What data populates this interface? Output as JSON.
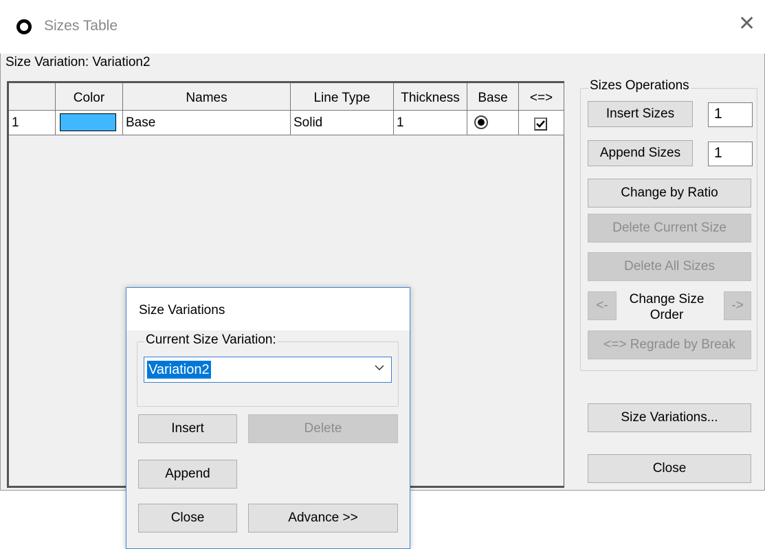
{
  "window": {
    "title": "Sizes Table",
    "close_glyph": "✕",
    "variation_label": "Size Variation: Variation2"
  },
  "grid": {
    "columns": [
      "Color",
      "Names",
      "Line Type",
      "Thickness",
      "Base",
      "<=>"
    ],
    "rows": [
      {
        "index": "1",
        "color": "#40b8ff",
        "name": "Base",
        "line_type": "Solid",
        "thickness": "1",
        "base_selected": true,
        "regrade_checked": true
      }
    ]
  },
  "sizes_operations": {
    "legend": "Sizes Operations",
    "insert_sizes_label": "Insert Sizes",
    "insert_sizes_count": "1",
    "append_sizes_label": "Append Sizes",
    "append_sizes_count": "1",
    "change_by_ratio_label": "Change by Ratio",
    "delete_current_label": "Delete Current Size",
    "delete_all_label": "Delete All Sizes",
    "order_prev_label": "<-",
    "order_label": "Change Size Order",
    "order_next_label": "->",
    "regrade_label": "<=> Regrade by Break"
  },
  "right_buttons": {
    "size_variations_label": "Size Variations...",
    "close_label": "Close"
  },
  "dialog": {
    "title": "Size Variations",
    "group_legend": "Current Size Variation:",
    "current_value": "Variation2",
    "insert_label": "Insert",
    "delete_label": "Delete",
    "append_label": "Append",
    "close_label": "Close",
    "advance_label": "Advance >>"
  }
}
